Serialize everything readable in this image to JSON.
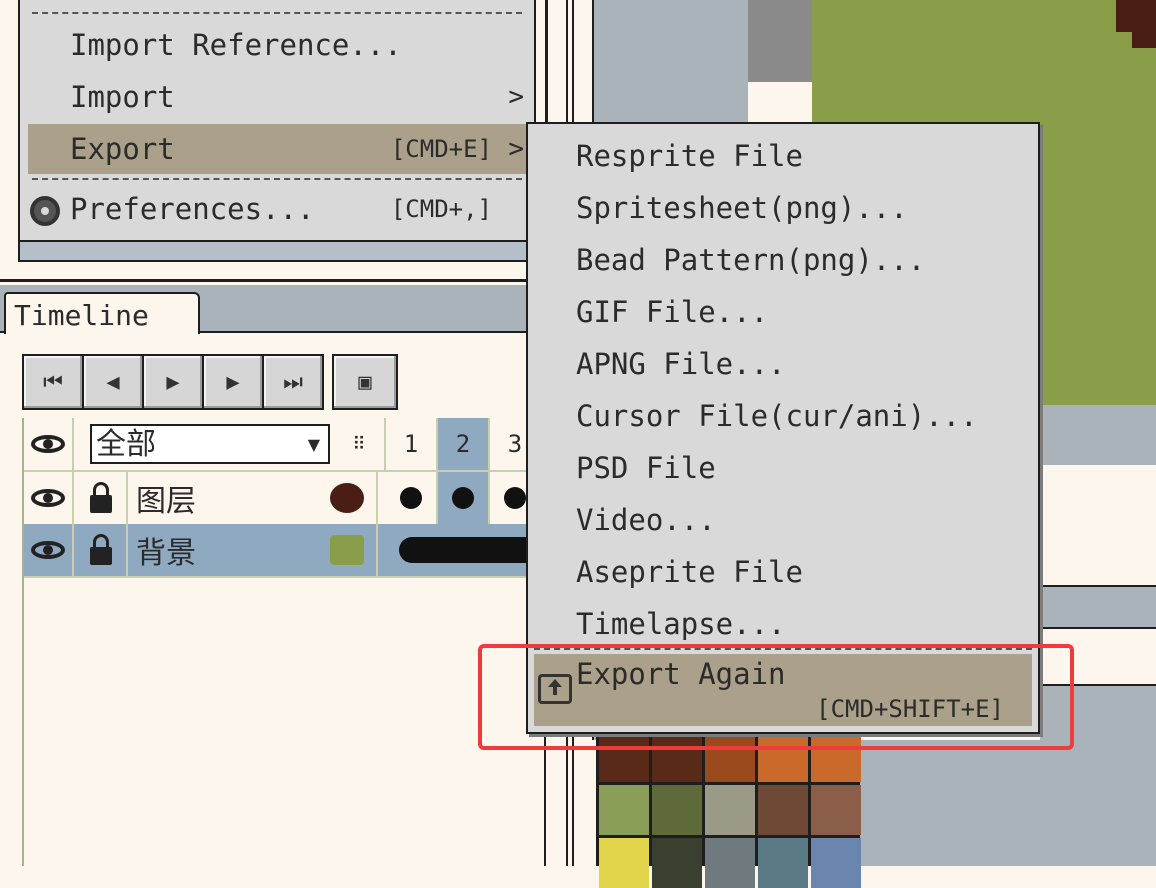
{
  "file_menu": {
    "items": [
      {
        "label": "Import Reference...",
        "shortcut": "",
        "arrow": ""
      },
      {
        "label": "Import",
        "shortcut": "",
        "arrow": ">"
      },
      {
        "label": "Export",
        "shortcut": "[CMD+E]",
        "arrow": ">"
      },
      {
        "label": "Preferences...",
        "shortcut": "[CMD+,]",
        "arrow": ""
      }
    ]
  },
  "timeline": {
    "tab_label": "Timeline",
    "buttons": [
      "first-frame",
      "previous-frame",
      "play",
      "next-frame",
      "last-frame",
      "loop"
    ],
    "layer_filter": "全部",
    "frames": [
      "1",
      "2",
      "3"
    ],
    "layers": [
      {
        "name": "图层",
        "color": "#4a1e14"
      },
      {
        "name": "背景",
        "color": "#8a9e4a"
      }
    ]
  },
  "export_submenu": {
    "items": [
      "Resprite File",
      "Spritesheet(png)...",
      "Bead Pattern(png)...",
      "GIF File...",
      "APNG File...",
      "Cursor File(cur/ani)...",
      "PSD File",
      "Video...",
      "Aseprite File",
      "Timelapse..."
    ],
    "export_again": {
      "label": "Export Again",
      "shortcut": "[CMD+SHIFT+E]"
    }
  },
  "palette": {
    "colors": [
      "#5a2a18",
      "#5a2a18",
      "#9b4a1e",
      "#c9692a",
      "#c9692a",
      "#8a9e5a",
      "#5f6a3a",
      "#9b9a86",
      "#6e4a36",
      "#8a5e48",
      "#e2d54c",
      "#3a4030",
      "#6e7a7e",
      "#5a7a86",
      "#6a86ae"
    ]
  },
  "colors": {
    "accent_highlight": "#ee3b3b",
    "menu_hover": "#aba08a"
  }
}
